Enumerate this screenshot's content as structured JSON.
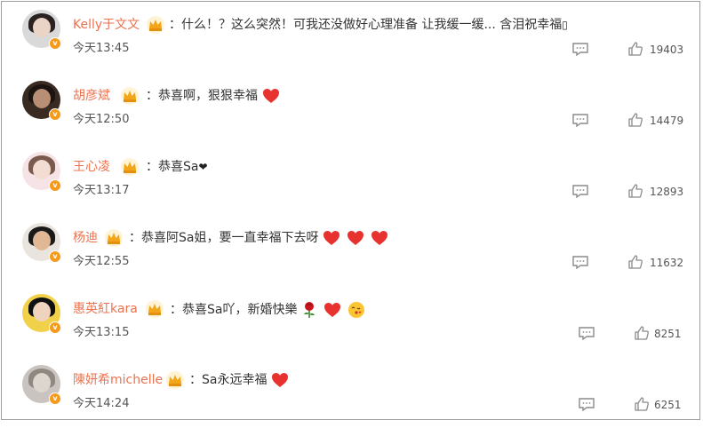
{
  "comments": [
    {
      "username": "Kelly于文文",
      "text": "：什么！？这么突然！可我还没做好心理准备 让我缓一缓... 含泪祝幸福",
      "trailing_glyph": "▯",
      "emojis": [],
      "time": "今天13:45",
      "likes": "19403",
      "avatar_colors": {
        "bg": "#d9d9d9",
        "hair": "#2a2222",
        "face": "#e9d4c6"
      }
    },
    {
      "username": "胡彦斌",
      "text": "：恭喜啊，狠狠幸福",
      "trailing_glyph": "",
      "emojis": [
        "heart-icon"
      ],
      "time": "今天12:50",
      "likes": "14479",
      "avatar_colors": {
        "bg": "#3a2b22",
        "hair": "#1b1410",
        "face": "#b88f74"
      }
    },
    {
      "username": "王心凌",
      "text": "：恭喜Sa",
      "trailing_glyph": "❤",
      "emojis": [],
      "time": "今天13:17",
      "likes": "12893",
      "avatar_colors": {
        "bg": "#f5e3e6",
        "hair": "#7a5a4c",
        "face": "#f3ddd3"
      }
    },
    {
      "username": "杨迪",
      "text": "：恭喜阿Sa姐，要一直幸福下去呀",
      "trailing_glyph": "",
      "emojis": [
        "heart-icon",
        "heart-icon",
        "heart-icon"
      ],
      "time": "今天12:55",
      "likes": "11632",
      "avatar_colors": {
        "bg": "#e9e4dd",
        "hair": "#1a1a1a",
        "face": "#e0b896"
      }
    },
    {
      "username": "惠英紅kara",
      "text": "：恭喜Sa吖，新婚快樂",
      "trailing_glyph": "",
      "emojis": [
        "rose-icon",
        "heart-icon",
        "kiss-face-icon"
      ],
      "time": "今天13:15",
      "likes": "8251",
      "avatar_colors": {
        "bg": "#f2d14a",
        "hair": "#111111",
        "face": "#f0d3bf"
      }
    },
    {
      "username": "陳妍希michelle",
      "text": "：Sa永远幸福",
      "trailing_glyph": "",
      "emojis": [
        "heart-icon"
      ],
      "time": "今天14:24",
      "likes": "6251",
      "avatar_colors": {
        "bg": "#c9c4bf",
        "hair": "#8f8881",
        "face": "#ddd6cf"
      }
    }
  ],
  "colors": {
    "username": "#eb7350",
    "heart": "#e8322f",
    "crown": "#f2a71b",
    "vbadge": "#f59a1a",
    "icon_gray": "#8a8a8a"
  }
}
